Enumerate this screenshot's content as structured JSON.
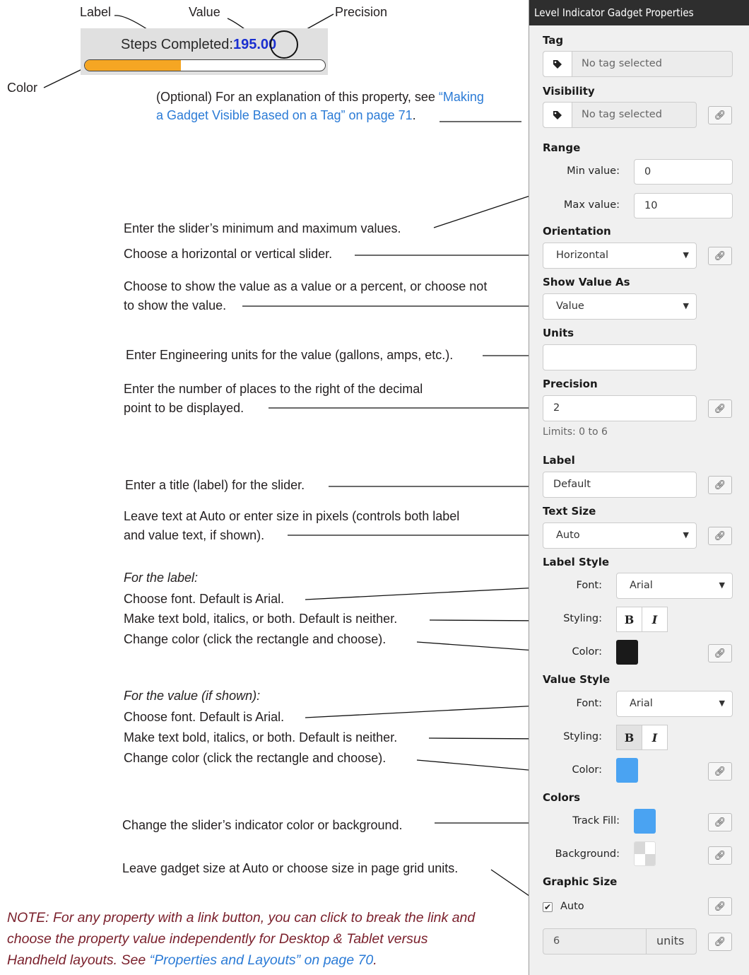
{
  "figure_labels": {
    "label": "Label",
    "value": "Value",
    "precision": "Precision",
    "color": "Color"
  },
  "sample_gadget": {
    "label": "Steps Completed:",
    "value_int": "195",
    "value_dec": ".00",
    "fill_fraction": 0.4,
    "fill_color": "#f5a623"
  },
  "annotations": {
    "visibility_p1": "(Optional) For an explanation of this property, see ",
    "visibility_link1": "“Making",
    "visibility_link2": "a Gadget Visible Based on a Tag” on page 71",
    "visibility_end": ".",
    "range": "Enter the slider’s minimum and maximum values.",
    "orientation": "Choose a horizontal or vertical slider.",
    "show_value_1": "Choose to show the value as a value or a percent, or choose not",
    "show_value_2": "to show the value.",
    "units": "Enter Engineering units for the value (gallons, amps, etc.).",
    "precision_1": "Enter the number of places to the right of the decimal",
    "precision_2": "point to be displayed.",
    "label": "Enter a title (label) for the slider.",
    "text_size_1": "Leave text at Auto or enter size in pixels (controls both label",
    "text_size_2": "and value text, if shown).",
    "for_label": "For the label:",
    "label_font": "Choose font. Default is Arial.",
    "label_styling": "Make text bold, italics, or both. Default is neither.",
    "label_color": "Change color (click the rectangle and choose).",
    "for_value": "For the value (if shown):",
    "value_font": "Choose font. Default is Arial.",
    "value_styling": "Make text bold, italics, or both. Default is neither.",
    "value_color": "Change color (click the rectangle and choose).",
    "colors": "Change the slider’s indicator color or background.",
    "graphic_size": "Leave gadget size at Auto or choose size in page grid units."
  },
  "note": {
    "line1": "NOTE: For any property with a link button, you can click to break the link and",
    "line2": "choose the property value independently for Desktop & Tablet versus",
    "line3_pre": "Handheld layouts. See ",
    "line3_link": "“Properties and Layouts” on page 70",
    "line3_end": "."
  },
  "panel": {
    "title": "Level Indicator Gadget Properties",
    "tag": {
      "heading": "Tag",
      "placeholder": "No tag selected"
    },
    "visibility": {
      "heading": "Visibility",
      "placeholder": "No tag selected"
    },
    "range": {
      "heading": "Range",
      "min_label": "Min value:",
      "min_value": "0",
      "max_label": "Max value:",
      "max_value": "10"
    },
    "orientation": {
      "heading": "Orientation",
      "value": "Horizontal"
    },
    "show_value_as": {
      "heading": "Show Value As",
      "value": "Value"
    },
    "units": {
      "heading": "Units",
      "value": ""
    },
    "precision": {
      "heading": "Precision",
      "value": "2",
      "limits": "Limits: 0 to 6"
    },
    "label": {
      "heading": "Label",
      "value": "Default"
    },
    "text_size": {
      "heading": "Text Size",
      "value": "Auto"
    },
    "label_style": {
      "heading": "Label Style",
      "font_label": "Font:",
      "font_value": "Arial",
      "styling_label": "Styling:",
      "bold": "B",
      "italic": "I",
      "color_label": "Color:",
      "color": "#1a1a1a"
    },
    "value_style": {
      "heading": "Value Style",
      "font_label": "Font:",
      "font_value": "Arial",
      "styling_label": "Styling:",
      "bold": "B",
      "italic": "I",
      "color_label": "Color:",
      "color": "#4aa3f2"
    },
    "colors": {
      "heading": "Colors",
      "track_fill_label": "Track Fill:",
      "track_fill": "#4aa3f2",
      "background_label": "Background:"
    },
    "graphic_size": {
      "heading": "Graphic Size",
      "auto_label": "Auto",
      "auto_checked": true,
      "size_value": "6",
      "units_label": "units"
    }
  },
  "icons": {
    "tag": "tag-icon",
    "link": "link-icon",
    "caret": "chevron-down-icon",
    "check": "check-icon"
  }
}
